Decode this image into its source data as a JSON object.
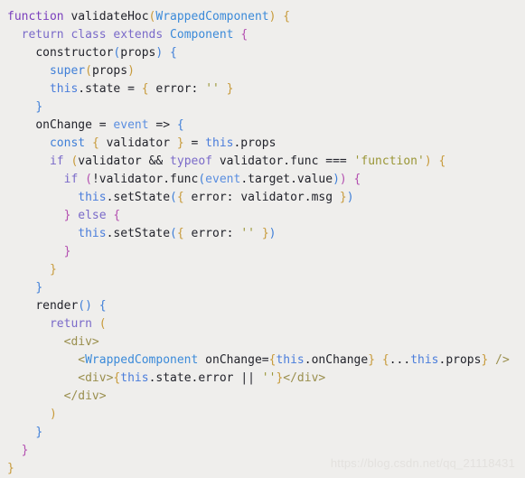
{
  "editor": {
    "background": "#efeeec",
    "language": "jsx",
    "font_size_px": 13,
    "line_height_px": 20,
    "watermark": "https://blog.csdn.net/qq_21118431",
    "watermark_color": "#e3e1de"
  },
  "palette": {
    "plain": "#22232b",
    "keyword": "#7a6ac9",
    "function_declaration": "#7a3fbd",
    "class_name": "#3b8ad9",
    "this_keyword": "#4a7ddb",
    "parameter": "#5a8ee0",
    "const_keyword": "#3f7fd8",
    "string": "#9a9636",
    "jsx_tag": "#9a8f4e",
    "bracket_level_1": "#c79a3a",
    "bracket_level_2": "#b34fb0",
    "bracket_level_3": "#3f7fd8"
  },
  "code": {
    "plain_text": "function validateHoc(WrappedComponent) {\n  return class extends Component {\n    constructor(props) {\n      super(props)\n      this.state = { error: '' }\n    }\n    onChange = event => {\n      const { validator } = this.props\n      if (validator && typeof validator.func === 'function') {\n        if (!validator.func(event.target.value)) {\n          this.setState({ error: validator.msg })\n        } else {\n          this.setState({ error: '' })\n        }\n      }\n    }\n    render() {\n      return (\n        <div>\n          <WrappedComponent onChange={this.onChange} {...this.props} />\n          <div>{this.state.error || ''}</div>\n        </div>\n      )\n    }\n  }\n}",
    "lines": [
      [
        {
          "t": "function",
          "c": "t-func-decl"
        },
        {
          "t": " ",
          "c": "t-plain"
        },
        {
          "t": "validateHoc",
          "c": "t-ident"
        },
        {
          "t": "(",
          "c": "t-b1"
        },
        {
          "t": "WrappedComponent",
          "c": "t-class"
        },
        {
          "t": ")",
          "c": "t-b1"
        },
        {
          "t": " ",
          "c": "t-plain"
        },
        {
          "t": "{",
          "c": "t-b1"
        }
      ],
      [
        {
          "t": "  ",
          "c": "t-plain"
        },
        {
          "t": "return",
          "c": "t-control"
        },
        {
          "t": " ",
          "c": "t-plain"
        },
        {
          "t": "class",
          "c": "t-keyword"
        },
        {
          "t": " ",
          "c": "t-plain"
        },
        {
          "t": "extends",
          "c": "t-keyword"
        },
        {
          "t": " ",
          "c": "t-plain"
        },
        {
          "t": "Component",
          "c": "t-class"
        },
        {
          "t": " ",
          "c": "t-plain"
        },
        {
          "t": "{",
          "c": "t-b2"
        }
      ],
      [
        {
          "t": "    ",
          "c": "t-plain"
        },
        {
          "t": "constructor",
          "c": "t-ident"
        },
        {
          "t": "(",
          "c": "t-b3"
        },
        {
          "t": "props",
          "c": "t-plain"
        },
        {
          "t": ")",
          "c": "t-b3"
        },
        {
          "t": " ",
          "c": "t-plain"
        },
        {
          "t": "{",
          "c": "t-b3"
        }
      ],
      [
        {
          "t": "      ",
          "c": "t-plain"
        },
        {
          "t": "super",
          "c": "t-const"
        },
        {
          "t": "(",
          "c": "t-b1"
        },
        {
          "t": "props",
          "c": "t-plain"
        },
        {
          "t": ")",
          "c": "t-b1"
        }
      ],
      [
        {
          "t": "      ",
          "c": "t-plain"
        },
        {
          "t": "this",
          "c": "t-this"
        },
        {
          "t": ".state ",
          "c": "t-plain"
        },
        {
          "t": "=",
          "c": "t-op"
        },
        {
          "t": " ",
          "c": "t-plain"
        },
        {
          "t": "{",
          "c": "t-b1"
        },
        {
          "t": " error: ",
          "c": "t-plain"
        },
        {
          "t": "''",
          "c": "t-string"
        },
        {
          "t": " ",
          "c": "t-plain"
        },
        {
          "t": "}",
          "c": "t-b1"
        }
      ],
      [
        {
          "t": "    ",
          "c": "t-plain"
        },
        {
          "t": "}",
          "c": "t-b3"
        }
      ],
      [
        {
          "t": "    ",
          "c": "t-plain"
        },
        {
          "t": "onChange ",
          "c": "t-ident"
        },
        {
          "t": "=",
          "c": "t-op"
        },
        {
          "t": " ",
          "c": "t-plain"
        },
        {
          "t": "event",
          "c": "t-param"
        },
        {
          "t": " ",
          "c": "t-plain"
        },
        {
          "t": "=>",
          "c": "t-op"
        },
        {
          "t": " ",
          "c": "t-plain"
        },
        {
          "t": "{",
          "c": "t-b3"
        }
      ],
      [
        {
          "t": "      ",
          "c": "t-plain"
        },
        {
          "t": "const",
          "c": "t-const"
        },
        {
          "t": " ",
          "c": "t-plain"
        },
        {
          "t": "{",
          "c": "t-b1"
        },
        {
          "t": " validator ",
          "c": "t-plain"
        },
        {
          "t": "}",
          "c": "t-b1"
        },
        {
          "t": " ",
          "c": "t-plain"
        },
        {
          "t": "=",
          "c": "t-op"
        },
        {
          "t": " ",
          "c": "t-plain"
        },
        {
          "t": "this",
          "c": "t-this"
        },
        {
          "t": ".props",
          "c": "t-plain"
        }
      ],
      [
        {
          "t": "      ",
          "c": "t-plain"
        },
        {
          "t": "if",
          "c": "t-control"
        },
        {
          "t": " ",
          "c": "t-plain"
        },
        {
          "t": "(",
          "c": "t-b1"
        },
        {
          "t": "validator ",
          "c": "t-plain"
        },
        {
          "t": "&&",
          "c": "t-op"
        },
        {
          "t": " ",
          "c": "t-plain"
        },
        {
          "t": "typeof",
          "c": "t-keyword"
        },
        {
          "t": " validator.func ",
          "c": "t-plain"
        },
        {
          "t": "===",
          "c": "t-op"
        },
        {
          "t": " ",
          "c": "t-plain"
        },
        {
          "t": "'function'",
          "c": "t-string"
        },
        {
          "t": ")",
          "c": "t-b1"
        },
        {
          "t": " ",
          "c": "t-plain"
        },
        {
          "t": "{",
          "c": "t-b1"
        }
      ],
      [
        {
          "t": "        ",
          "c": "t-plain"
        },
        {
          "t": "if",
          "c": "t-control"
        },
        {
          "t": " ",
          "c": "t-plain"
        },
        {
          "t": "(",
          "c": "t-b2"
        },
        {
          "t": "!validator.func",
          "c": "t-plain"
        },
        {
          "t": "(",
          "c": "t-b3"
        },
        {
          "t": "event",
          "c": "t-param"
        },
        {
          "t": ".target.value",
          "c": "t-plain"
        },
        {
          "t": ")",
          "c": "t-b3"
        },
        {
          "t": ")",
          "c": "t-b2"
        },
        {
          "t": " ",
          "c": "t-plain"
        },
        {
          "t": "{",
          "c": "t-b2"
        }
      ],
      [
        {
          "t": "          ",
          "c": "t-plain"
        },
        {
          "t": "this",
          "c": "t-this"
        },
        {
          "t": ".setState",
          "c": "t-plain"
        },
        {
          "t": "(",
          "c": "t-b3"
        },
        {
          "t": "{",
          "c": "t-b1"
        },
        {
          "t": " error: validator.msg ",
          "c": "t-plain"
        },
        {
          "t": "}",
          "c": "t-b1"
        },
        {
          "t": ")",
          "c": "t-b3"
        }
      ],
      [
        {
          "t": "        ",
          "c": "t-plain"
        },
        {
          "t": "}",
          "c": "t-b2"
        },
        {
          "t": " ",
          "c": "t-plain"
        },
        {
          "t": "else",
          "c": "t-control"
        },
        {
          "t": " ",
          "c": "t-plain"
        },
        {
          "t": "{",
          "c": "t-b2"
        }
      ],
      [
        {
          "t": "          ",
          "c": "t-plain"
        },
        {
          "t": "this",
          "c": "t-this"
        },
        {
          "t": ".setState",
          "c": "t-plain"
        },
        {
          "t": "(",
          "c": "t-b3"
        },
        {
          "t": "{",
          "c": "t-b1"
        },
        {
          "t": " error: ",
          "c": "t-plain"
        },
        {
          "t": "''",
          "c": "t-string"
        },
        {
          "t": " ",
          "c": "t-plain"
        },
        {
          "t": "}",
          "c": "t-b1"
        },
        {
          "t": ")",
          "c": "t-b3"
        }
      ],
      [
        {
          "t": "        ",
          "c": "t-plain"
        },
        {
          "t": "}",
          "c": "t-b2"
        }
      ],
      [
        {
          "t": "      ",
          "c": "t-plain"
        },
        {
          "t": "}",
          "c": "t-b1"
        }
      ],
      [
        {
          "t": "    ",
          "c": "t-plain"
        },
        {
          "t": "}",
          "c": "t-b3"
        }
      ],
      [
        {
          "t": "    ",
          "c": "t-plain"
        },
        {
          "t": "render",
          "c": "t-ident"
        },
        {
          "t": "(",
          "c": "t-b3"
        },
        {
          "t": ")",
          "c": "t-b3"
        },
        {
          "t": " ",
          "c": "t-plain"
        },
        {
          "t": "{",
          "c": "t-b3"
        }
      ],
      [
        {
          "t": "      ",
          "c": "t-plain"
        },
        {
          "t": "return",
          "c": "t-control"
        },
        {
          "t": " ",
          "c": "t-plain"
        },
        {
          "t": "(",
          "c": "t-b1"
        }
      ],
      [
        {
          "t": "        ",
          "c": "t-plain"
        },
        {
          "t": "<div>",
          "c": "t-tag"
        }
      ],
      [
        {
          "t": "          ",
          "c": "t-plain"
        },
        {
          "t": "<",
          "c": "t-tag"
        },
        {
          "t": "WrappedComponent",
          "c": "t-class"
        },
        {
          "t": " ",
          "c": "t-plain"
        },
        {
          "t": "onChange",
          "c": "t-attr"
        },
        {
          "t": "=",
          "c": "t-op"
        },
        {
          "t": "{",
          "c": "t-b1"
        },
        {
          "t": "this",
          "c": "t-this"
        },
        {
          "t": ".onChange",
          "c": "t-plain"
        },
        {
          "t": "}",
          "c": "t-b1"
        },
        {
          "t": " ",
          "c": "t-plain"
        },
        {
          "t": "{",
          "c": "t-b1"
        },
        {
          "t": "...",
          "c": "t-op"
        },
        {
          "t": "this",
          "c": "t-this"
        },
        {
          "t": ".props",
          "c": "t-plain"
        },
        {
          "t": "}",
          "c": "t-b1"
        },
        {
          "t": " ",
          "c": "t-plain"
        },
        {
          "t": "/>",
          "c": "t-tag"
        }
      ],
      [
        {
          "t": "          ",
          "c": "t-plain"
        },
        {
          "t": "<div>",
          "c": "t-tag"
        },
        {
          "t": "{",
          "c": "t-b1"
        },
        {
          "t": "this",
          "c": "t-this"
        },
        {
          "t": ".state.error ",
          "c": "t-plain"
        },
        {
          "t": "||",
          "c": "t-op"
        },
        {
          "t": " ",
          "c": "t-plain"
        },
        {
          "t": "''",
          "c": "t-string"
        },
        {
          "t": "}",
          "c": "t-b1"
        },
        {
          "t": "</div>",
          "c": "t-tag"
        }
      ],
      [
        {
          "t": "        ",
          "c": "t-plain"
        },
        {
          "t": "</div>",
          "c": "t-tag"
        }
      ],
      [
        {
          "t": "      ",
          "c": "t-plain"
        },
        {
          "t": ")",
          "c": "t-b1"
        }
      ],
      [
        {
          "t": "    ",
          "c": "t-plain"
        },
        {
          "t": "}",
          "c": "t-b3"
        }
      ],
      [
        {
          "t": "  ",
          "c": "t-plain"
        },
        {
          "t": "}",
          "c": "t-b2"
        }
      ],
      [
        {
          "t": "}",
          "c": "t-b1"
        }
      ]
    ]
  }
}
